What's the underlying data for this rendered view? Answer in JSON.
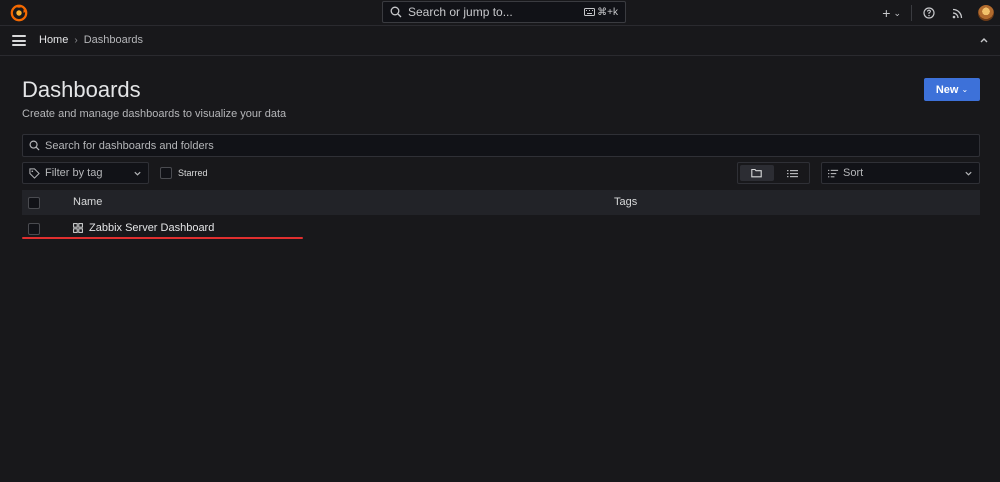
{
  "topbar": {
    "search_placeholder": "Search or jump to...",
    "search_shortcut": "⌘+k",
    "plus_symbol": "+",
    "chevron_symbol": "⌄"
  },
  "breadcrumb": {
    "home": "Home",
    "separator": "›",
    "current": "Dashboards"
  },
  "page": {
    "title": "Dashboards",
    "subtitle": "Create and manage dashboards to visualize your data",
    "new_button": "New",
    "new_chevron": "⌄"
  },
  "search": {
    "placeholder": "Search for dashboards and folders"
  },
  "filters": {
    "tag_filter": "Filter by tag",
    "starred_label": "Starred",
    "sort_label": "Sort"
  },
  "table": {
    "columns": [
      "Name",
      "Tags"
    ],
    "rows": [
      {
        "name": "Zabbix Server Dashboard",
        "tags": ""
      }
    ]
  },
  "colors": {
    "primary": "#3d71d9",
    "annotation_underline": "#e02f2f",
    "logo": "#f46800"
  }
}
